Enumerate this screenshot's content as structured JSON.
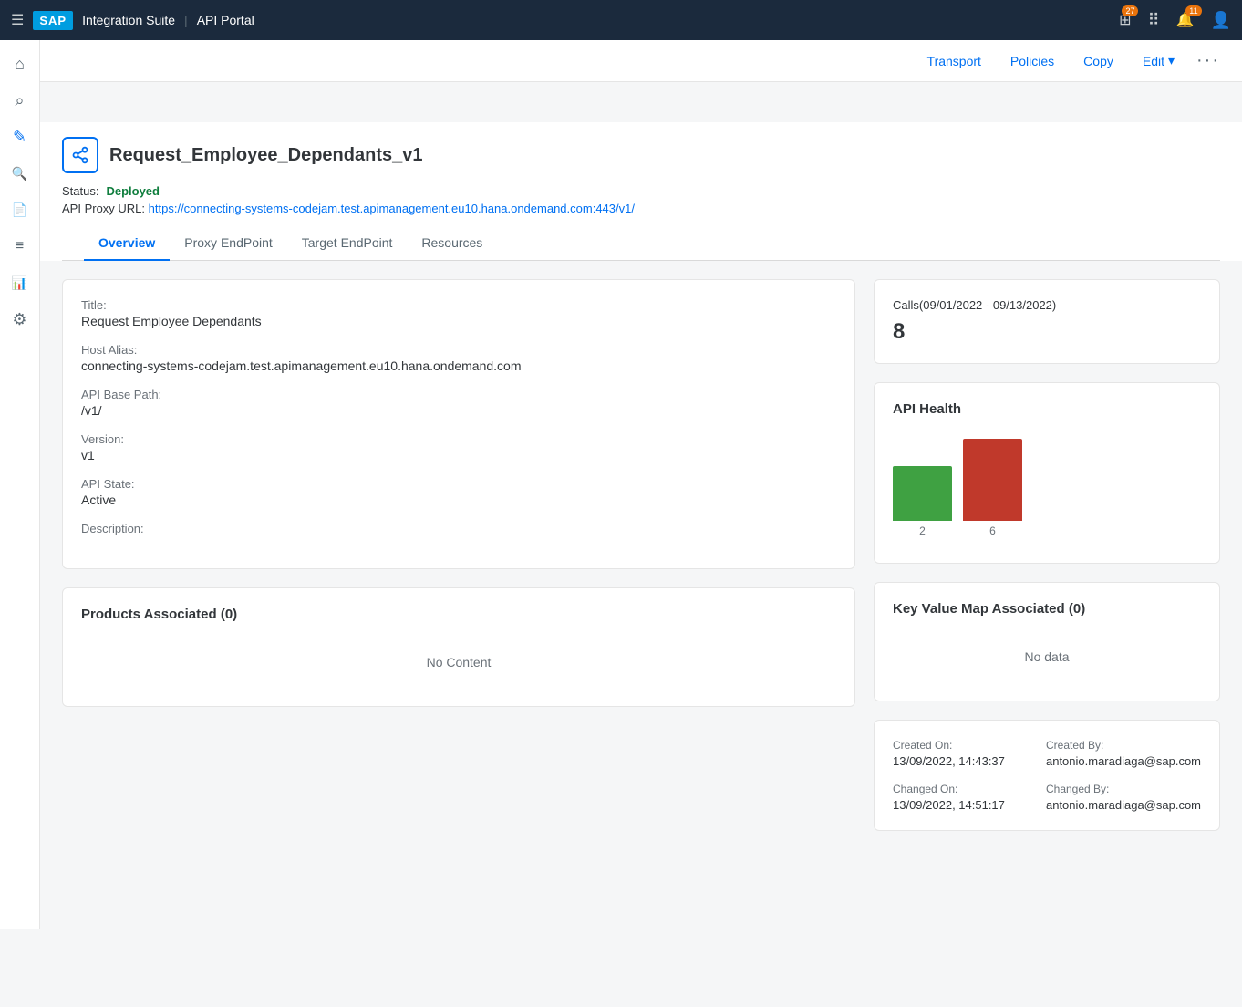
{
  "topnav": {
    "logo": "SAP",
    "app_title": "Integration Suite",
    "portal_title": "API Portal",
    "menu_icon": "☰",
    "notifications_count": "11",
    "grid_icon": "⊞",
    "bell_icon": "🔔",
    "user_icon": "👤",
    "apps_badge": "27"
  },
  "action_bar": {
    "transport_label": "Transport",
    "policies_label": "Policies",
    "copy_label": "Copy",
    "edit_label": "Edit",
    "edit_chevron": "▾",
    "more_label": "···"
  },
  "sidebar": {
    "items": [
      {
        "name": "home",
        "icon": "⌂",
        "active": false
      },
      {
        "name": "search",
        "icon": "⌕",
        "active": false
      },
      {
        "name": "edit",
        "icon": "✎",
        "active": true
      },
      {
        "name": "magnify",
        "icon": "🔍",
        "active": false
      },
      {
        "name": "document",
        "icon": "📄",
        "active": false
      },
      {
        "name": "list",
        "icon": "☰",
        "active": false
      },
      {
        "name": "chart",
        "icon": "📊",
        "active": false
      },
      {
        "name": "settings",
        "icon": "⚙",
        "active": false
      }
    ]
  },
  "page": {
    "api_icon": "share",
    "api_name": "Request_Employee_Dependants_v1",
    "status_label": "Status:",
    "status_value": "Deployed",
    "proxy_url_label": "API Proxy URL:",
    "proxy_url": "https://connecting-systems-codejam.test.apimanagement.eu10.hana.ondemand.com:443/v1/"
  },
  "tabs": [
    {
      "id": "overview",
      "label": "Overview",
      "active": true
    },
    {
      "id": "proxy",
      "label": "Proxy EndPoint",
      "active": false
    },
    {
      "id": "target",
      "label": "Target EndPoint",
      "active": false
    },
    {
      "id": "resources",
      "label": "Resources",
      "active": false
    }
  ],
  "overview_card": {
    "title_label": "Title:",
    "title_value": "Request Employee Dependants",
    "host_alias_label": "Host Alias:",
    "host_alias_value": "connecting-systems-codejam.test.apimanagement.eu10.hana.ondemand.com",
    "base_path_label": "API Base Path:",
    "base_path_value": "/v1/",
    "version_label": "Version:",
    "version_value": "v1",
    "api_state_label": "API State:",
    "api_state_value": "Active",
    "description_label": "Description:",
    "description_value": ""
  },
  "products_card": {
    "title": "Products Associated (0)",
    "no_content": "No Content"
  },
  "calls_card": {
    "title": "Calls(09/01/2022 - 09/13/2022)",
    "count": "8"
  },
  "health_card": {
    "title": "API Health",
    "bars": [
      {
        "value": 2,
        "color": "#3fa142",
        "height": 60,
        "label": "2"
      },
      {
        "value": 6,
        "color": "#c0392b",
        "height": 90,
        "label": "6"
      }
    ]
  },
  "kvm_card": {
    "title": "Key Value Map Associated (0)",
    "no_data": "No data"
  },
  "metadata_card": {
    "created_on_label": "Created On:",
    "created_on_value": "13/09/2022, 14:43:37",
    "created_by_label": "Created By:",
    "created_by_value": "antonio.maradiaga@sap.com",
    "changed_on_label": "Changed On:",
    "changed_on_value": "13/09/2022, 14:51:17",
    "changed_by_label": "Changed By:",
    "changed_by_value": "antonio.maradiaga@sap.com"
  }
}
